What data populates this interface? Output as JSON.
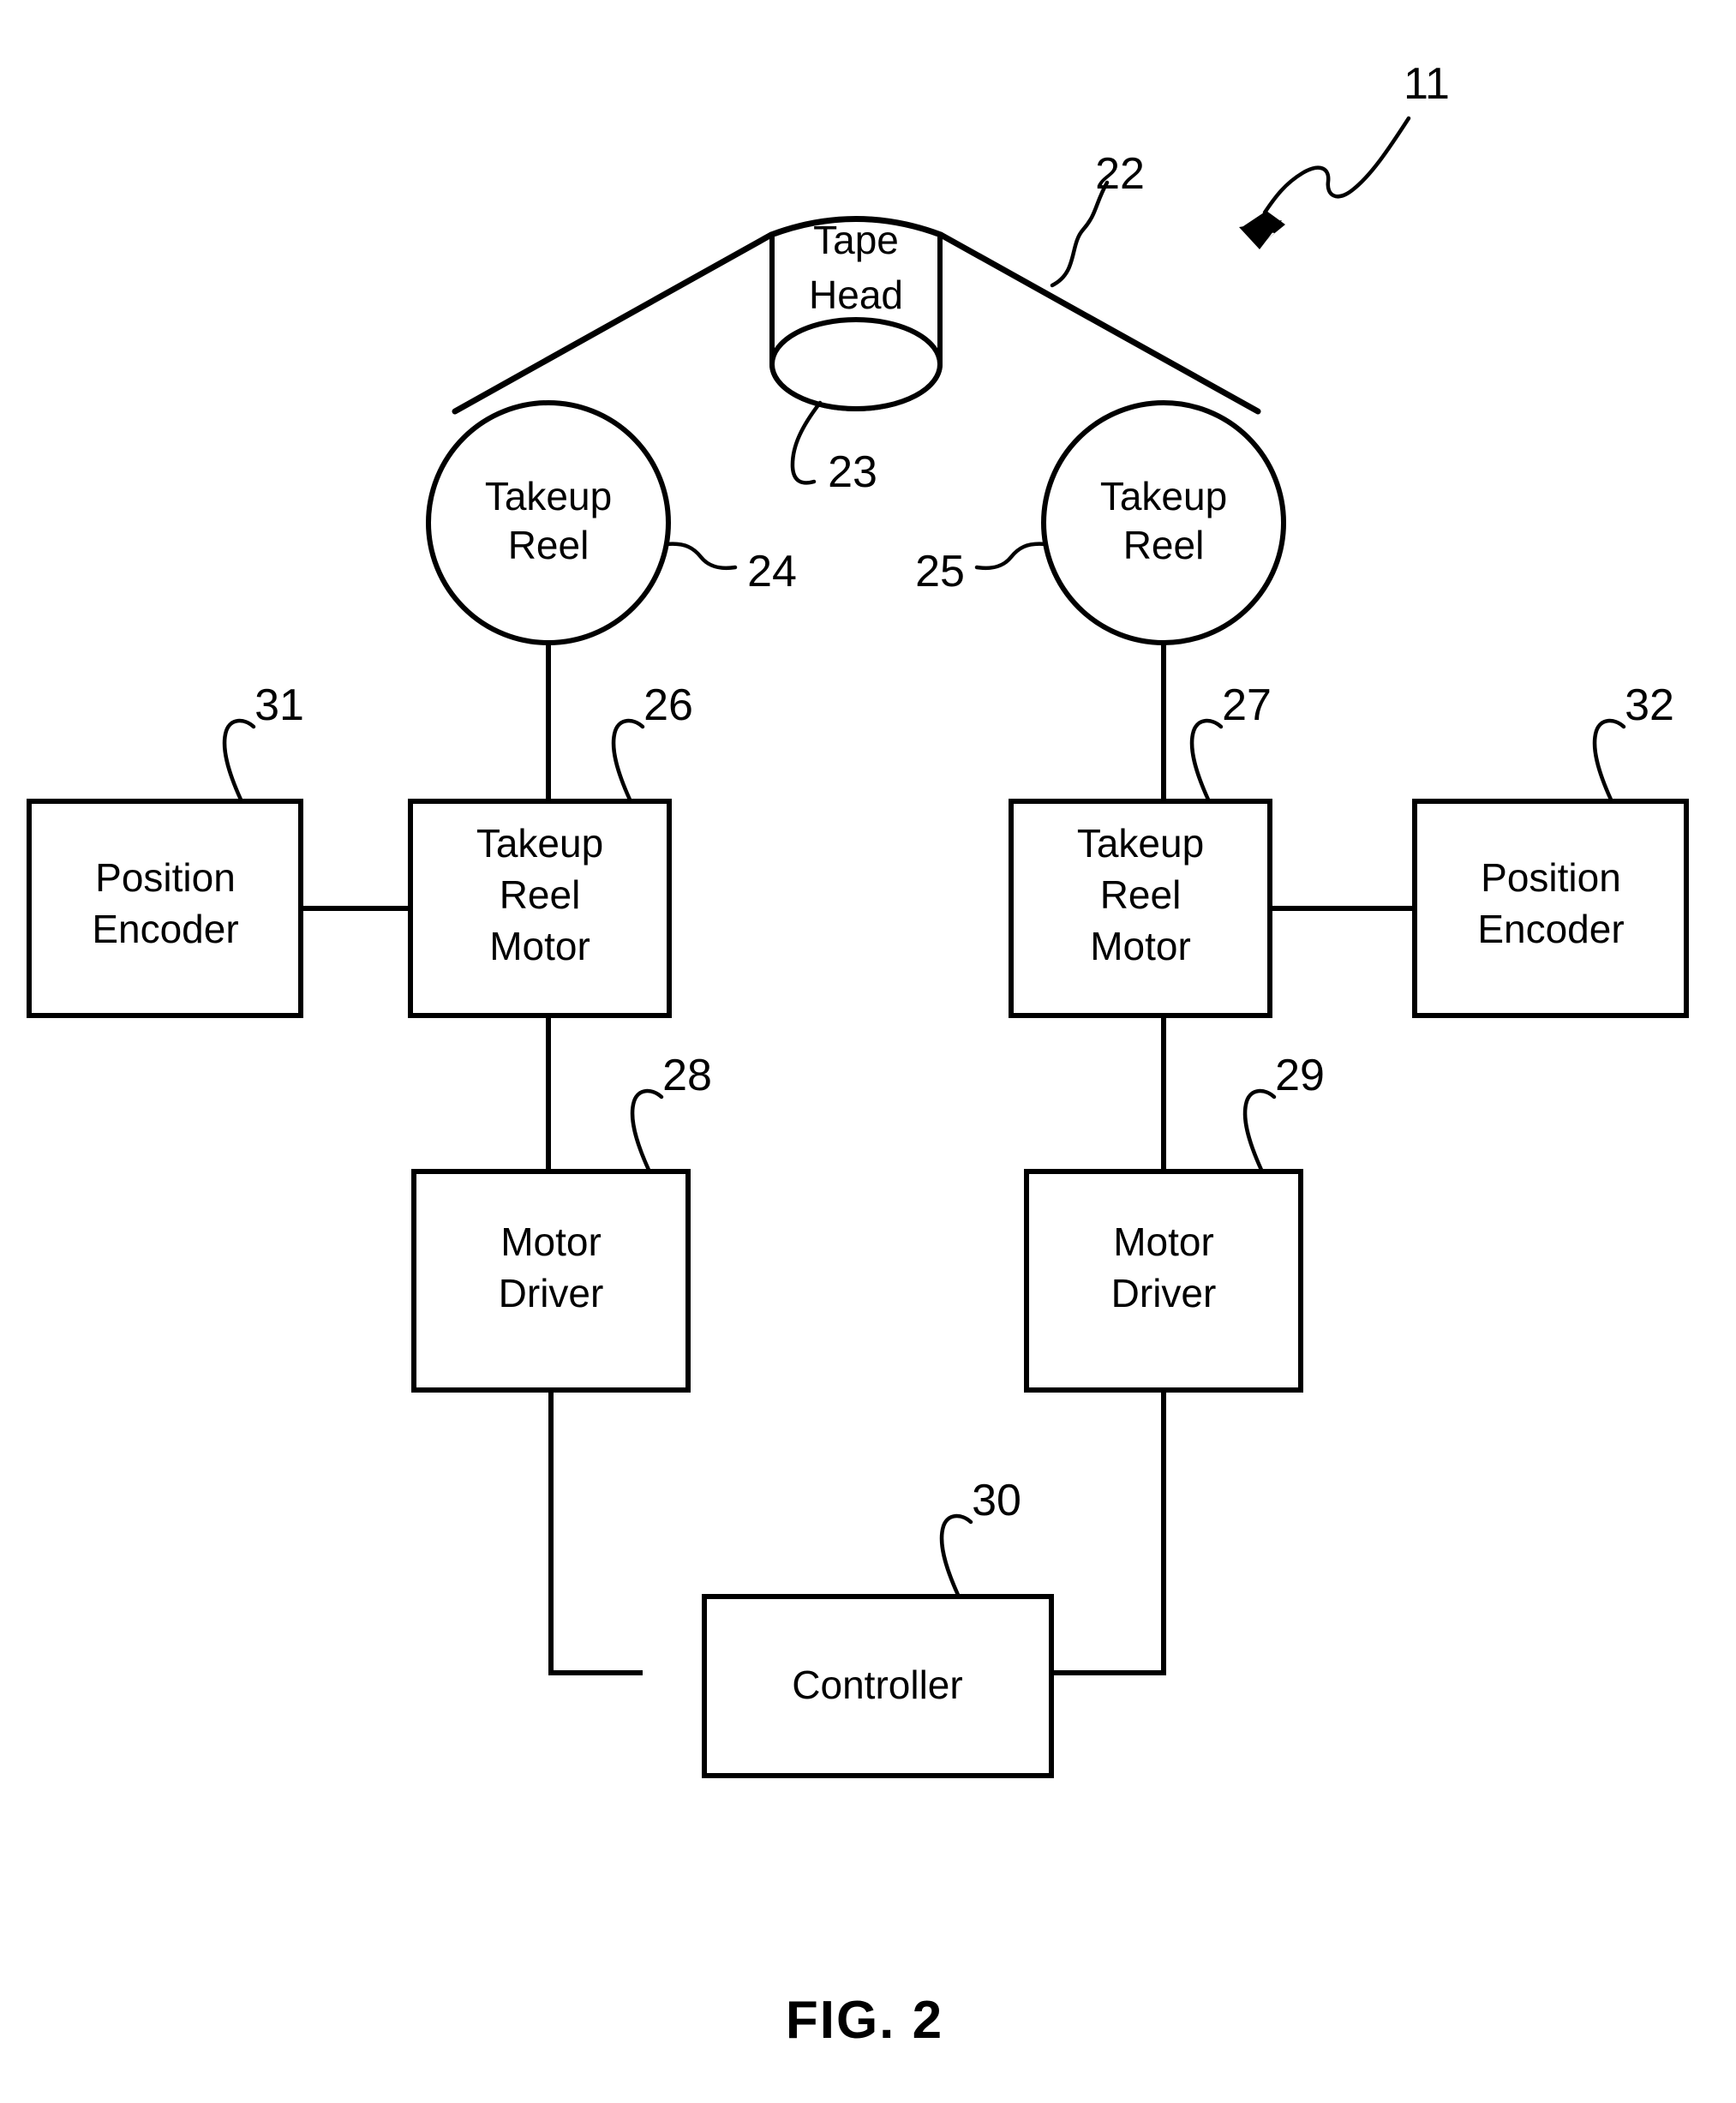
{
  "figure": {
    "caption": "FIG. 2",
    "assembly_ref": "11"
  },
  "components": {
    "tape_head": {
      "label_line1": "Tape",
      "label_line2": "Head",
      "ref": "23"
    },
    "tape": {
      "ref": "22"
    },
    "left_reel": {
      "label_line1": "Takeup",
      "label_line2": "Reel",
      "ref": "24"
    },
    "right_reel": {
      "label_line1": "Takeup",
      "label_line2": "Reel",
      "ref": "25"
    },
    "left_motor": {
      "label_line1": "Takeup",
      "label_line2": "Reel",
      "label_line3": "Motor",
      "ref": "26"
    },
    "right_motor": {
      "label_line1": "Takeup",
      "label_line2": "Reel",
      "label_line3": "Motor",
      "ref": "27"
    },
    "left_encoder": {
      "label_line1": "Position",
      "label_line2": "Encoder",
      "ref": "31"
    },
    "right_encoder": {
      "label_line1": "Position",
      "label_line2": "Encoder",
      "ref": "32"
    },
    "left_driver": {
      "label_line1": "Motor",
      "label_line2": "Driver",
      "ref": "28"
    },
    "right_driver": {
      "label_line1": "Motor",
      "label_line2": "Driver",
      "ref": "29"
    },
    "controller": {
      "label": "Controller",
      "ref": "30"
    }
  },
  "colors": {
    "ink": "#000000",
    "paper": "#ffffff"
  }
}
